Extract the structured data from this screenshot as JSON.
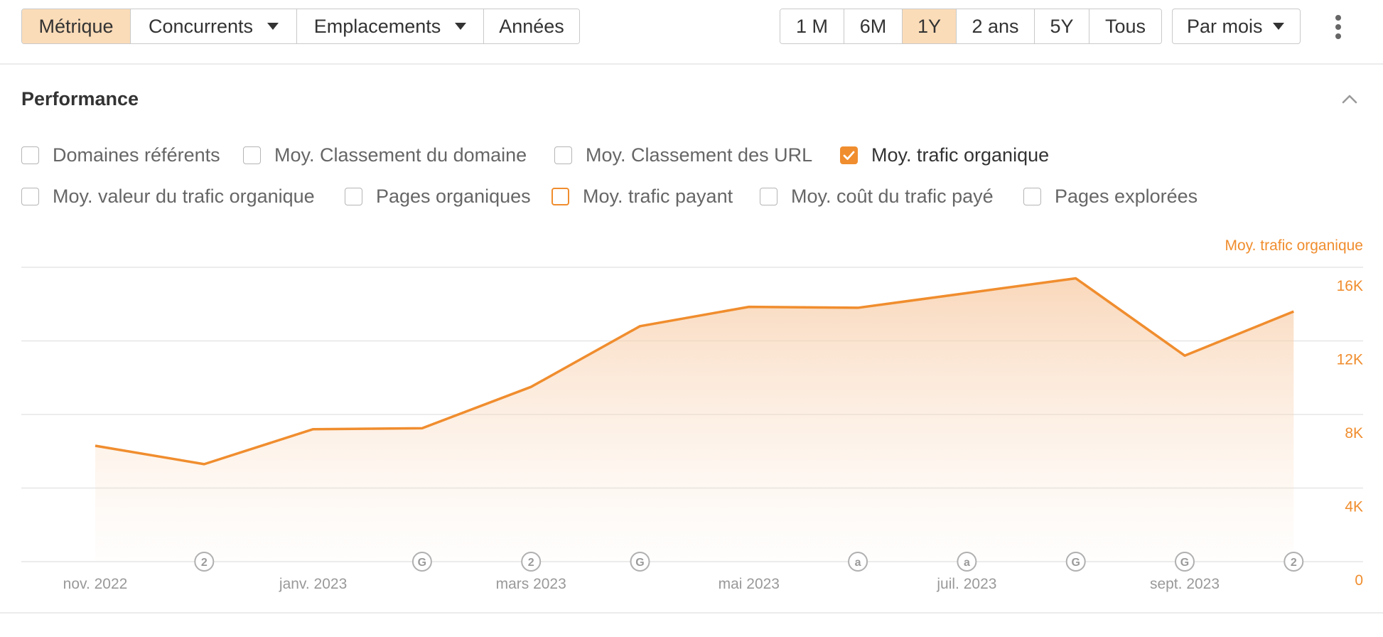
{
  "toolbar": {
    "group1": [
      {
        "label": "Métrique",
        "active": true,
        "caret": false
      },
      {
        "label": "Concurrents",
        "active": false,
        "caret": true
      },
      {
        "label": "Emplacements",
        "active": false,
        "caret": true
      },
      {
        "label": "Années",
        "active": false,
        "caret": false
      }
    ],
    "ranges": [
      {
        "label": "1 M",
        "active": false
      },
      {
        "label": "6M",
        "active": false
      },
      {
        "label": "1Y",
        "active": true
      },
      {
        "label": "2 ans",
        "active": false
      },
      {
        "label": "5Y",
        "active": false
      },
      {
        "label": "Tous",
        "active": false
      }
    ],
    "granularity": "Par mois"
  },
  "section": {
    "title": "Performance"
  },
  "metrics": [
    {
      "label": "Domaines référents",
      "state": "unchecked"
    },
    {
      "label": "Moy. Classement du domaine",
      "state": "unchecked"
    },
    {
      "label": "Moy. Classement des URL",
      "state": "unchecked"
    },
    {
      "label": "Moy. trafic organique",
      "state": "checked"
    },
    {
      "label": "Moy. valeur du trafic organique",
      "state": "unchecked"
    },
    {
      "label": "Pages organiques",
      "state": "unchecked"
    },
    {
      "label": "Moy. trafic payant",
      "state": "outlined"
    },
    {
      "label": "Moy. coût du trafic payé",
      "state": "unchecked"
    },
    {
      "label": "Pages explorées",
      "state": "unchecked"
    }
  ],
  "colors": {
    "accent": "#f08d2e",
    "accent_fill": "#fbdcb8",
    "grid": "#e6e6e6",
    "axis_text": "#999999"
  },
  "chart_data": {
    "type": "area",
    "series": [
      {
        "name": "Moy. trafic organique",
        "x": [
          "2022-11",
          "2022-12",
          "2023-01",
          "2023-02",
          "2023-03",
          "2023-04",
          "2023-05",
          "2023-06",
          "2023-07",
          "2023-08",
          "2023-09",
          "2023-10"
        ],
        "values": [
          6300,
          5300,
          7200,
          7250,
          9500,
          12800,
          13850,
          13800,
          14600,
          15400,
          11200,
          13600
        ]
      }
    ],
    "x_tick_labels": [
      "nov. 2022",
      "janv. 2023",
      "mars 2023",
      "mai 2023",
      "juil. 2023",
      "sept. 2023"
    ],
    "y_ticks": [
      {
        "value": 0,
        "label": "0"
      },
      {
        "value": 4000,
        "label": "4K"
      },
      {
        "value": 8000,
        "label": "8K"
      },
      {
        "value": 12000,
        "label": "12K"
      },
      {
        "value": 16000,
        "label": "16K"
      }
    ],
    "ylabel": "Moy. trafic organique",
    "ylim": [
      0,
      16000
    ],
    "grid": true,
    "annotations": [
      {
        "month": "2022-12",
        "glyph": "2"
      },
      {
        "month": "2023-02",
        "glyph": "G"
      },
      {
        "month": "2023-03",
        "glyph": "2"
      },
      {
        "month": "2023-04",
        "glyph": "G"
      },
      {
        "month": "2023-06",
        "glyph": "a"
      },
      {
        "month": "2023-07",
        "glyph": "a"
      },
      {
        "month": "2023-08",
        "glyph": "G"
      },
      {
        "month": "2023-09",
        "glyph": "G"
      },
      {
        "month": "2023-10",
        "glyph": "2"
      }
    ]
  }
}
